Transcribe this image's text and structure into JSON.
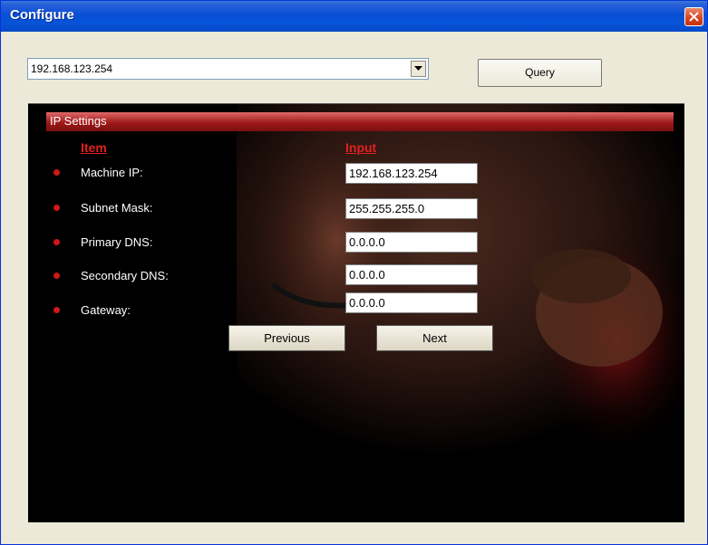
{
  "window": {
    "title": "Configure"
  },
  "device_select": {
    "value": "192.168.123.254"
  },
  "query_button": {
    "label": "Query"
  },
  "ip_settings": {
    "header": "IP Settings",
    "column_item": "Item",
    "column_input": "Input",
    "rows": [
      {
        "label": "Machine IP:",
        "value": "192.168.123.254"
      },
      {
        "label": "Subnet Mask:",
        "value": "255.255.255.0"
      },
      {
        "label": "Primary DNS:",
        "value": "0.0.0.0"
      },
      {
        "label": "Secondary DNS:",
        "value": "0.0.0.0"
      },
      {
        "label": "Gateway:",
        "value": "0.0.0.0"
      }
    ],
    "previous_label": "Previous",
    "next_label": "Next"
  },
  "colors": {
    "accent_red": "#d01818",
    "title_blue": "#0a4ed6"
  },
  "icons": {
    "close": "close-icon",
    "dropdown": "chevron-down-icon",
    "bullet": "bullet-icon"
  }
}
